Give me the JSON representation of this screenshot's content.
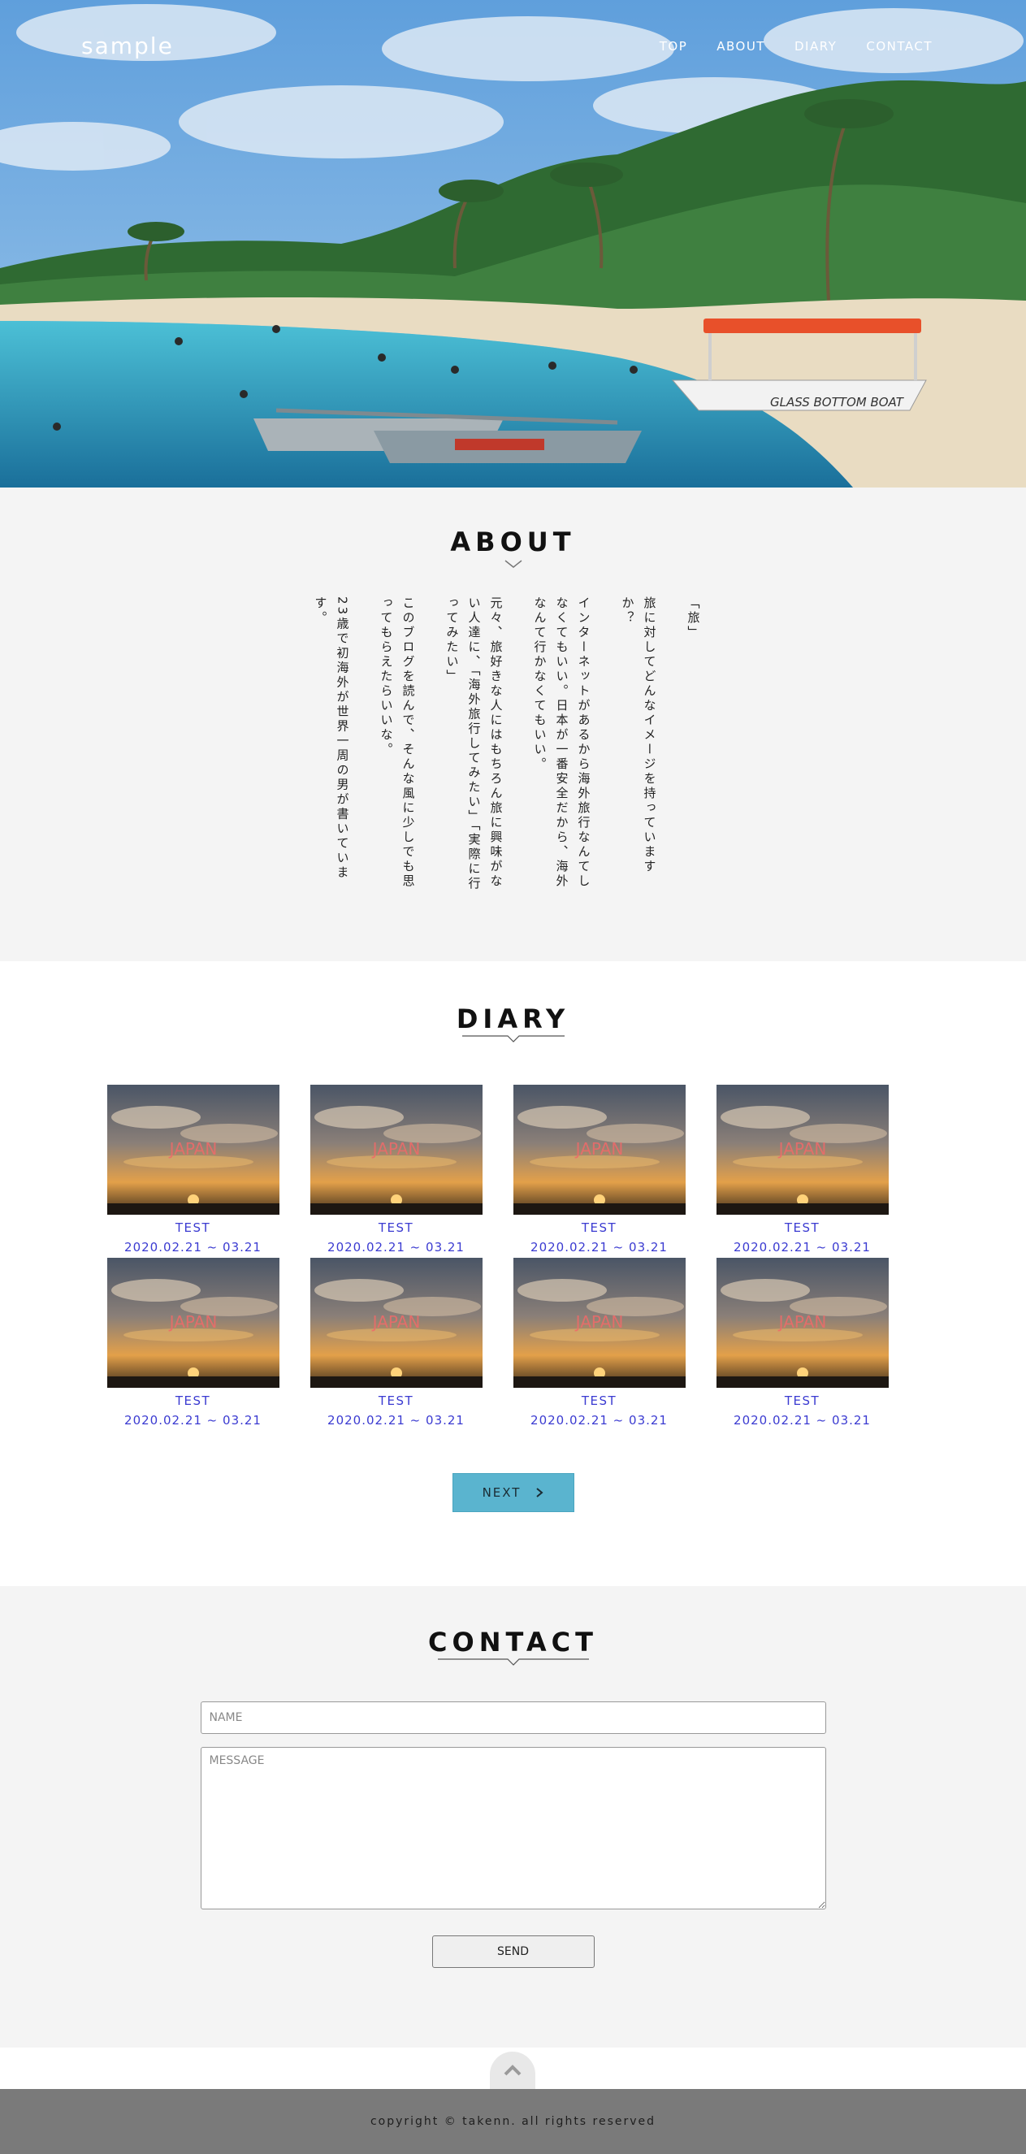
{
  "header": {
    "logo": "sample",
    "nav": [
      {
        "label": "TOP"
      },
      {
        "label": "ABOUT"
      },
      {
        "label": "DIARY"
      },
      {
        "label": "CONTACT"
      }
    ],
    "hero_boat_text": "GLASS BOTTOM BOAT"
  },
  "about": {
    "title": "ABOUT",
    "paragraphs": [
      "「旅」",
      "旅に対してどんなイメージを持っていますか？",
      "インターネットがあるから海外旅行なんてしなくてもいい。日本が一番安全だから、海外なんて行かなくてもいい。",
      "元々、旅好きな人にはもちろん旅に興味がない人達に、「海外旅行してみたい」「実際に行ってみたい」",
      "このブログを読んで、そんな風に少しでも思ってもらえたらいいな。",
      "23歳で初海外が世界一周の男が書いています。"
    ]
  },
  "diary": {
    "title": "DIARY",
    "thumb_text": "JAPAN",
    "entries": [
      {
        "title": "TEST",
        "date": "2020.02.21 ~ 03.21"
      },
      {
        "title": "TEST",
        "date": "2020.02.21 ~ 03.21"
      },
      {
        "title": "TEST",
        "date": "2020.02.21 ~ 03.21"
      },
      {
        "title": "TEST",
        "date": "2020.02.21 ~ 03.21"
      },
      {
        "title": "TEST",
        "date": "2020.02.21 ~ 03.21"
      },
      {
        "title": "TEST",
        "date": "2020.02.21 ~ 03.21"
      },
      {
        "title": "TEST",
        "date": "2020.02.21 ~ 03.21"
      },
      {
        "title": "TEST",
        "date": "2020.02.21 ~ 03.21"
      }
    ],
    "next_label": "NEXT",
    "next_icon": "chevron-right-icon"
  },
  "contact": {
    "title": "CONTACT",
    "name_placeholder": "NAME",
    "message_placeholder": "MESSAGE",
    "send_label": "SEND"
  },
  "footer": {
    "to_top_icon": "chevron-up-icon",
    "copyright": "copyright © takenn. all rights reserved"
  },
  "colors": {
    "accent": "#5ab4cf",
    "link": "#3b3bd1",
    "section_gray": "#f4f4f4",
    "footer": "#7a7a7a"
  }
}
